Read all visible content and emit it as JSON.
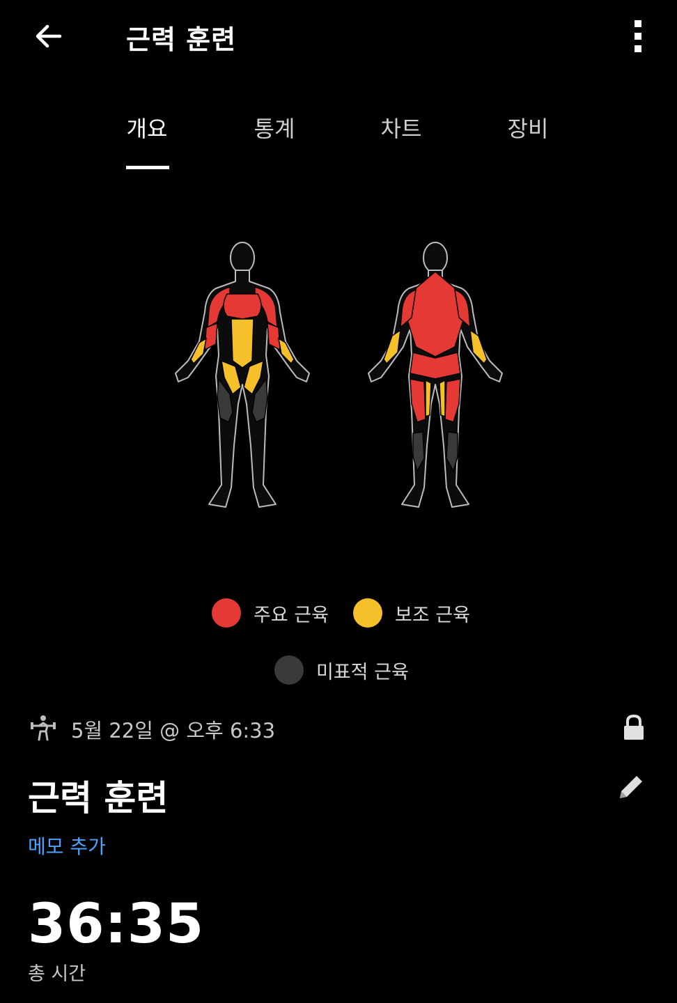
{
  "header": {
    "title": "근력 훈련",
    "back_icon": "arrow-left-icon",
    "more_icon": "more-vertical-icon"
  },
  "tabs": [
    {
      "label": "개요",
      "active": true
    },
    {
      "label": "통계",
      "active": false
    },
    {
      "label": "차트",
      "active": false
    },
    {
      "label": "장비",
      "active": false
    }
  ],
  "legend": [
    {
      "label": "주요 근육",
      "color": "#e53935"
    },
    {
      "label": "보조 근육",
      "color": "#f6c02a"
    },
    {
      "label": "미표적 근육",
      "color": "#3a3a3a"
    }
  ],
  "activity": {
    "icon": "strength-training-icon",
    "datetime": "5월 22일 @ 오후 6:33",
    "lock_icon": "lock-icon"
  },
  "workout": {
    "title": "근력 훈련",
    "edit_icon": "pencil-icon",
    "memo_label": "메모 추가"
  },
  "summary": {
    "total_time": "36:35",
    "total_time_label": "총 시간"
  },
  "colors": {
    "background": "#000000",
    "primary_muscle": "#e53935",
    "secondary_muscle": "#f6c02a",
    "untargeted_muscle": "#3a3a3a",
    "link": "#4aa3ff"
  }
}
